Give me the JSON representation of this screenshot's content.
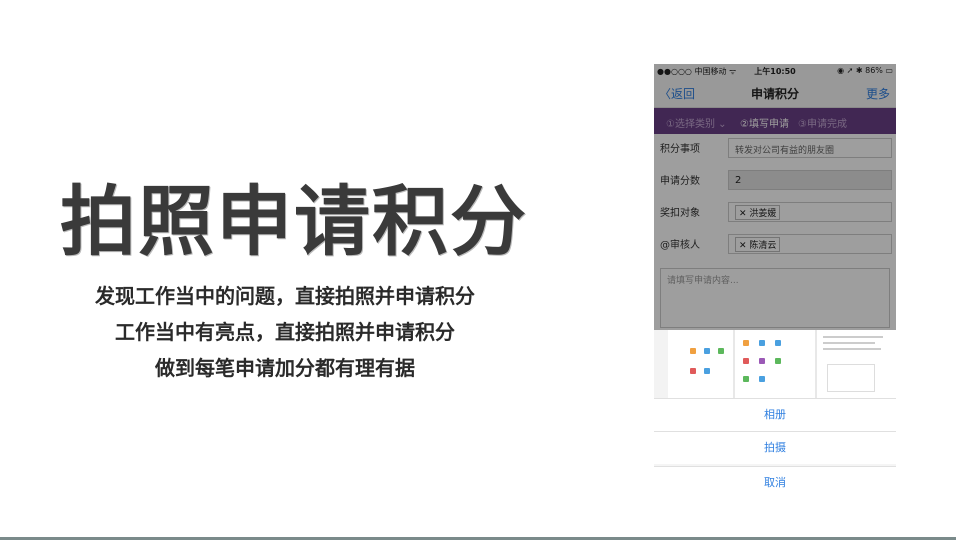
{
  "slide": {
    "title": "拍照申请积分",
    "lines": [
      "发现工作当中的问题，直接拍照并申请积分",
      "工作当中有亮点，直接拍照并申请积分",
      "做到每笔申请加分都有理有据"
    ]
  },
  "phone": {
    "status": {
      "left": "●●○○○ 中国移动 ᯤ",
      "time": "上午10:50",
      "right": "◉ ➚ ✱ 86% ▭"
    },
    "nav": {
      "back": "返回",
      "title": "申请积分",
      "more": "更多"
    },
    "steps": [
      "①选择类别 ⌄",
      "②填写申请",
      "③申请完成"
    ],
    "form": {
      "item_label": "积分事项",
      "item_value": "转发对公司有益的朋友圈",
      "score_label": "申请分数",
      "score_value": "2",
      "target_label": "奖扣对象",
      "target_value": "洪姜媛",
      "reviewer_label": "@审核人",
      "reviewer_value": "陈清云",
      "content_placeholder": "请填写申请内容..."
    },
    "sheet": {
      "album": "相册",
      "camera": "拍摄",
      "cancel": "取消"
    },
    "colors": {
      "accent": "#2f7fe0",
      "steps_bg": "#6a3f86"
    }
  }
}
